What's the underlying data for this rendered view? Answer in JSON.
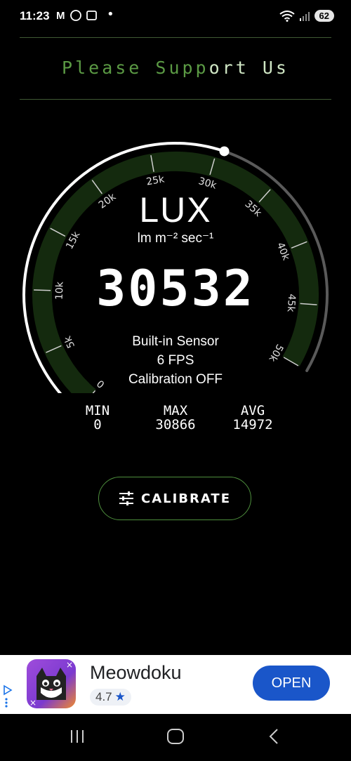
{
  "status": {
    "time": "11:23",
    "left_icons": "MⓈ▣",
    "battery": "62"
  },
  "banner": {
    "part1": "Please Supp",
    "part2": "ort Us"
  },
  "gauge": {
    "unit_title": "LUX",
    "unit_subtitle": "lm m⁻² sec⁻¹",
    "reading": "30532",
    "value": 30532,
    "max_value": 50000,
    "tick_labels": [
      "0",
      "5k",
      "10k",
      "15k",
      "20k",
      "25k",
      "30k",
      "35k",
      "40k",
      "45k",
      "50k"
    ],
    "colors": {
      "band": "#142a0e",
      "arc": "#ffffff",
      "track": "#5a5a5a"
    }
  },
  "info": {
    "sensor": "Built-in Sensor",
    "fps": "6 FPS",
    "calibration": "Calibration OFF"
  },
  "stats": {
    "min_label": "MIN",
    "min_value": "0",
    "max_label": "MAX",
    "max_value": "30866",
    "avg_label": "AVG",
    "avg_value": "14972"
  },
  "calibrate_button": {
    "label": "CALIBRATE",
    "icon": "sliders-icon"
  },
  "ad": {
    "title": "Meowdoku",
    "rating": "4.7",
    "open_label": "OPEN"
  },
  "accent_color": "#5b9a44"
}
